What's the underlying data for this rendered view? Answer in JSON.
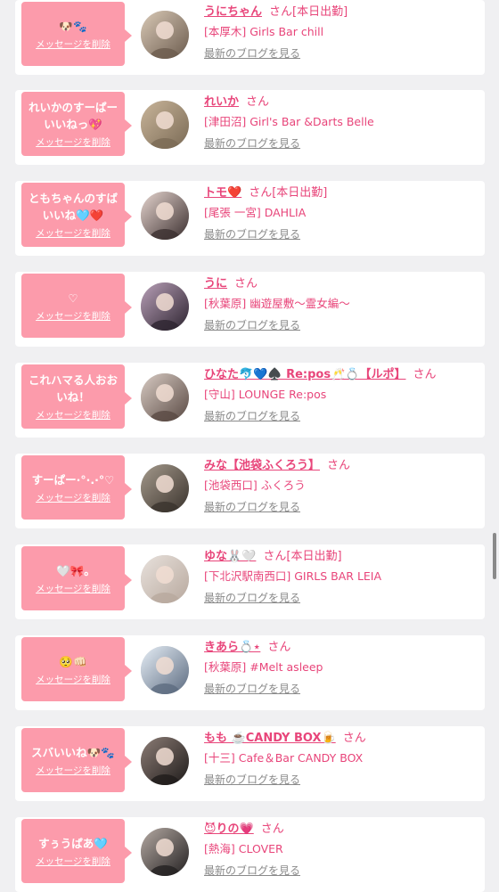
{
  "labels": {
    "delete": "メッセージを削除",
    "san": "さん",
    "blog": "最新のブログを見る"
  },
  "items": [
    {
      "message": "🐶🐾",
      "name": "うにちゃん",
      "today": "[本日出勤]",
      "shop": "[本厚木] Girls Bar chill",
      "avatar_colors": [
        "#d9c9b6",
        "#6b5b4e"
      ]
    },
    {
      "message": "れいかのすーぱーいいねっ💖",
      "name": "れいか",
      "today": "",
      "shop": "[津田沼] Girl's Bar &Darts Belle",
      "avatar_colors": [
        "#c9b59a",
        "#7a6a55"
      ]
    },
    {
      "message": "ともちゃんのすばいいね🩵❤️",
      "name": "トモ❤️",
      "today": "[本日出勤]",
      "shop": "[尾張 一宮] DAHLIA",
      "avatar_colors": [
        "#e6d5cf",
        "#3b2f2f"
      ]
    },
    {
      "message": "♡",
      "name": "うに",
      "today": "",
      "shop": "[秋葉原] 幽遊屋敷〜霊女編〜",
      "avatar_colors": [
        "#b9a0b8",
        "#2d2430"
      ]
    },
    {
      "message": "これハマる人おおいね！",
      "name": "ひなた🐬💙♠️ Re:pos🥂💍【ルポ】",
      "today": "",
      "shop": "[守山] LOUNGE Re:pos",
      "avatar_colors": [
        "#d8cbc3",
        "#5a4a44"
      ]
    },
    {
      "message": "すーぱー·°·.·°♡",
      "name": "みな【池袋ふくろう】",
      "today": "",
      "shop": "[池袋西口] ふくろう",
      "avatar_colors": [
        "#a59a8c",
        "#3a332d"
      ]
    },
    {
      "message": "🤍🎀｡",
      "name": "ゆな🐰🤍",
      "today": "[本日出勤]",
      "shop": "[下北沢駅南西口] GIRLS BAR LEIA",
      "avatar_colors": [
        "#e8e1dc",
        "#b8a99e"
      ]
    },
    {
      "message": "🥺👊🏻",
      "name": "きあら💍⋆",
      "today": "",
      "shop": "[秋葉原] #Melt asleep",
      "avatar_colors": [
        "#e6eef6",
        "#5c6b80"
      ]
    },
    {
      "message": "スバいいね🐶🐾",
      "name": "もも ☕️CANDY BOX🍺",
      "today": "",
      "shop": "[十三] Cafe＆Bar CANDY BOX",
      "avatar_colors": [
        "#8c7d76",
        "#1f1b1a"
      ]
    },
    {
      "message": "すぅうぱあ🩵",
      "name": "😈りの💗",
      "today": "",
      "shop": "[熱海] CLOVER",
      "avatar_colors": [
        "#b5aaa3",
        "#232021"
      ]
    }
  ]
}
